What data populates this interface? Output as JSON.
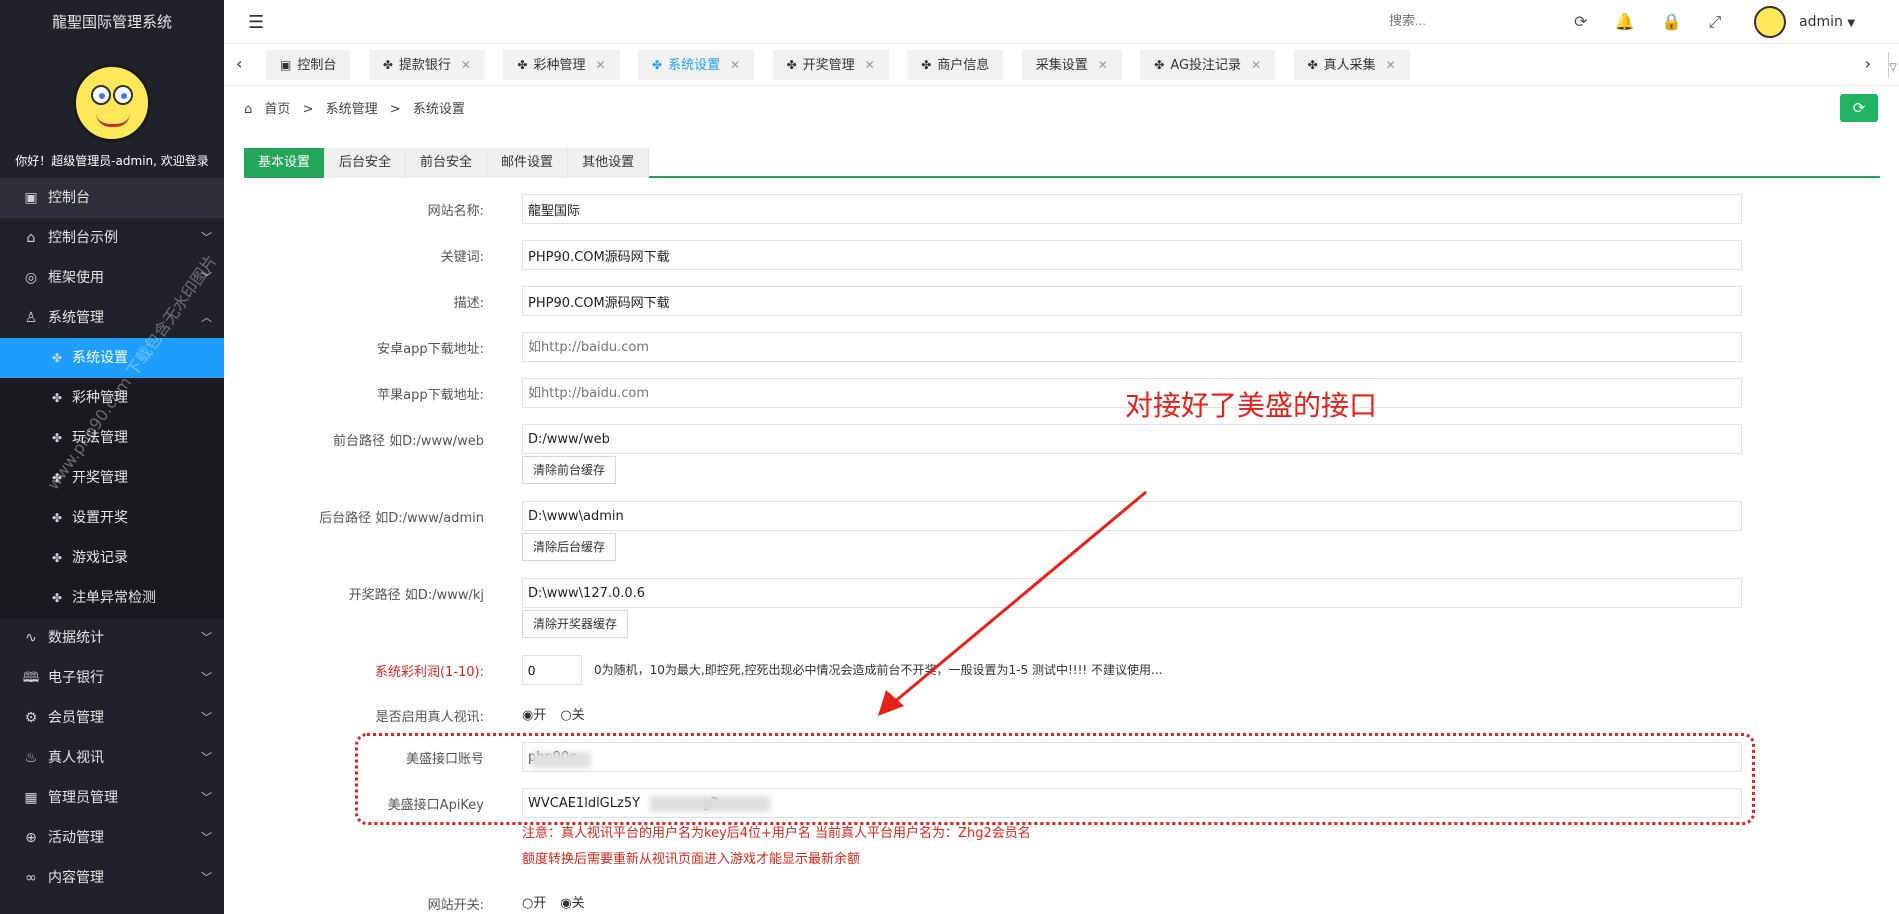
{
  "app": {
    "title": "龍聖国际管理系统"
  },
  "profile": {
    "greeting": "你好！超级管理员-admin, 欢迎登录"
  },
  "menu": [
    {
      "label": "控制台",
      "icon": "monitor-icon"
    },
    {
      "label": "控制台示例",
      "icon": "home-icon"
    },
    {
      "label": "框架使用",
      "icon": "ok-icon"
    },
    {
      "label": "系统管理",
      "icon": "user-icon"
    },
    {
      "label": "系统设置",
      "icon": "fan-icon"
    },
    {
      "label": "彩种管理",
      "icon": "fan-icon"
    },
    {
      "label": "玩法管理",
      "icon": "fan-icon"
    },
    {
      "label": "开奖管理",
      "icon": "fan-icon"
    },
    {
      "label": "设置开奖",
      "icon": "fan-icon"
    },
    {
      "label": "游戏记录",
      "icon": "fan-icon"
    },
    {
      "label": "注单异常检测",
      "icon": "fan-icon"
    },
    {
      "label": "数据统计",
      "icon": "pulse-icon"
    },
    {
      "label": "电子银行",
      "icon": "bank-icon"
    },
    {
      "label": "会员管理",
      "icon": "gear-icon"
    },
    {
      "label": "真人视讯",
      "icon": "fire-icon"
    },
    {
      "label": "管理员管理",
      "icon": "grid-icon"
    },
    {
      "label": "活动管理",
      "icon": "plus-circle-icon"
    },
    {
      "label": "内容管理",
      "icon": "link-icon"
    }
  ],
  "header": {
    "search_placeholder": "搜索...",
    "user": "admin"
  },
  "tabs": [
    "控制台",
    "提款银行",
    "彩种管理",
    "系统设置",
    "开奖管理",
    "商户信息",
    "采集设置",
    "AG投注记录",
    "真人采集"
  ],
  "breadcrumb": [
    "首页",
    ">",
    "系统管理",
    ">",
    "系统设置"
  ],
  "content_tabs": [
    "基本设置",
    "后台安全",
    "前台安全",
    "邮件设置",
    "其他设置"
  ],
  "form": {
    "site_name_label": "网站名称:",
    "site_name": "龍聖国际",
    "keywords_label": "关键词:",
    "keywords": "PHP90.COM源码网下载",
    "desc_label": "描述:",
    "desc": "PHP90.COM源码网下载",
    "android_label": "安卓app下载地址:",
    "android_placeholder": "如http://baidu.com",
    "ios_label": "苹果app下载地址:",
    "ios_placeholder": "如http://baidu.com",
    "front_path_label": "前台路径 如D:/www/web",
    "front_path": "D:/www/web",
    "front_btn": "清除前台缓存",
    "admin_path_label": "后台路径 如D:/www/admin",
    "admin_path": "D:\\www\\admin",
    "admin_btn": "清除后台缓存",
    "kj_path_label": "开奖路径 如D:/www/kj",
    "kj_path": "D:\\www\\127.0.0.6",
    "kj_btn": "清除开奖器缓存",
    "profit_label": "系统彩利润(1-10):",
    "profit": "0",
    "profit_note": "0为随机，10为最大,即控死,控死出现必中情况会造成前台不开奖，一般设置为1-5 测试中!!!! 不建议使用...",
    "live_label": "是否启用真人视讯:",
    "live_on": "◉开",
    "live_off": "○关",
    "ms_account_label": "美盛接口账号",
    "ms_account": "php90c",
    "ms_key_label": "美盛接口ApiKey",
    "ms_key": "WVCAE1ldlGLz5Y               g2",
    "note1": "注意：真人视讯平台的用户名为key后4位+用户名 当前真人平台用户名为：Zhg2会员名",
    "note2": "额度转换后需要重新从视讯页面进入游戏才能显示最新余额",
    "site_switch_label": "网站开关:",
    "switch_on": "○开",
    "switch_off": "◉关"
  },
  "annotation": "对接好了美盛的接口",
  "watermark": "www.php90.com 下载包含无水印图片"
}
